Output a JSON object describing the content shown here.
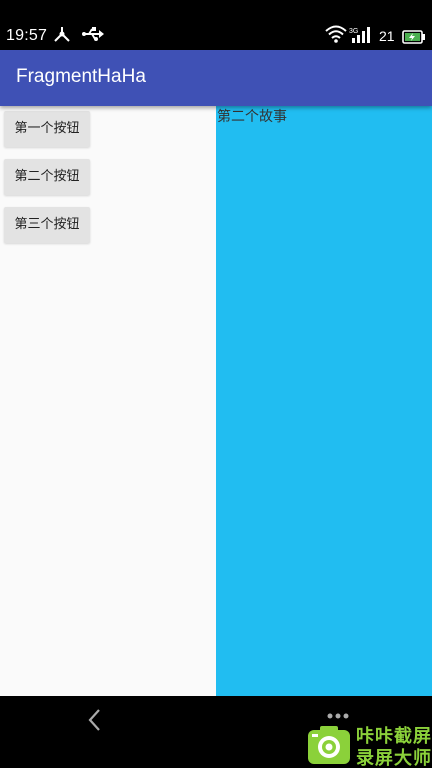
{
  "status_bar": {
    "time": "19:57",
    "battery_level": "21",
    "icons": [
      "usb-icon",
      "usb-stick-icon",
      "wifi-icon",
      "3g-signal-icon",
      "battery-charging-icon"
    ]
  },
  "app_bar": {
    "title": "FragmentHaHa",
    "color": "#3f51b5"
  },
  "left_fragment": {
    "buttons": [
      {
        "label": "第一个按钮"
      },
      {
        "label": "第二个按钮"
      },
      {
        "label": "第三个按钮"
      }
    ]
  },
  "right_fragment": {
    "text": "第二个故事",
    "background": "#21bdf1"
  },
  "nav_bar": {
    "icons": [
      "back-chevron-icon",
      "menu-dots-icon"
    ]
  },
  "watermark": {
    "line1": "咔咔截屏",
    "line2": "录屏大师",
    "color": "#8bd13a"
  }
}
